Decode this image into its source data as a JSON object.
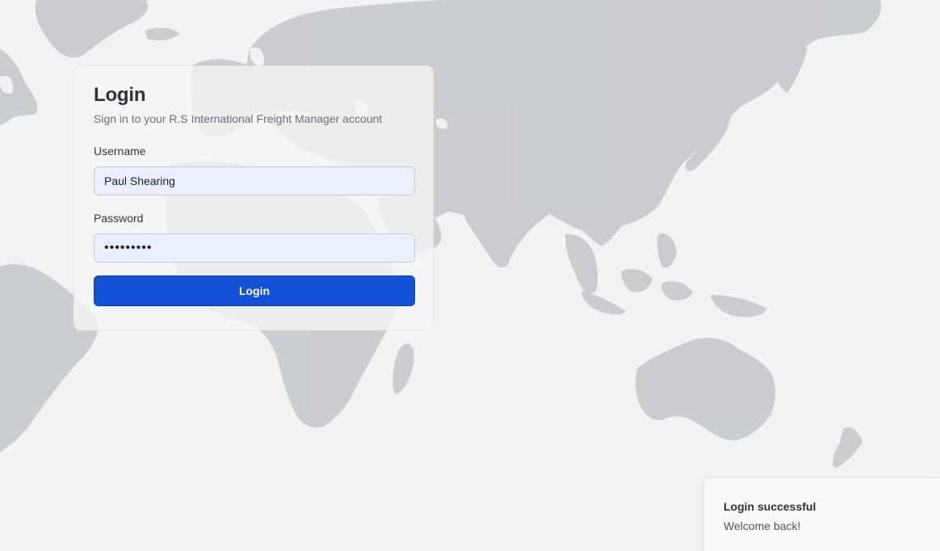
{
  "login": {
    "title": "Login",
    "subtitle": "Sign in to your R.S International Freight Manager account",
    "username_label": "Username",
    "username_value": "Paul Shearing",
    "password_label": "Password",
    "password_value": "•••••••••",
    "submit_label": "Login"
  },
  "toast": {
    "title": "Login successful",
    "message": "Welcome back!"
  },
  "colors": {
    "primary_button": "#1253d6",
    "input_autofill_bg": "#e8f0fe",
    "map_land": "#c9cccf",
    "page_background": "#f1f2f2"
  },
  "background": {
    "icon": "world-map"
  }
}
